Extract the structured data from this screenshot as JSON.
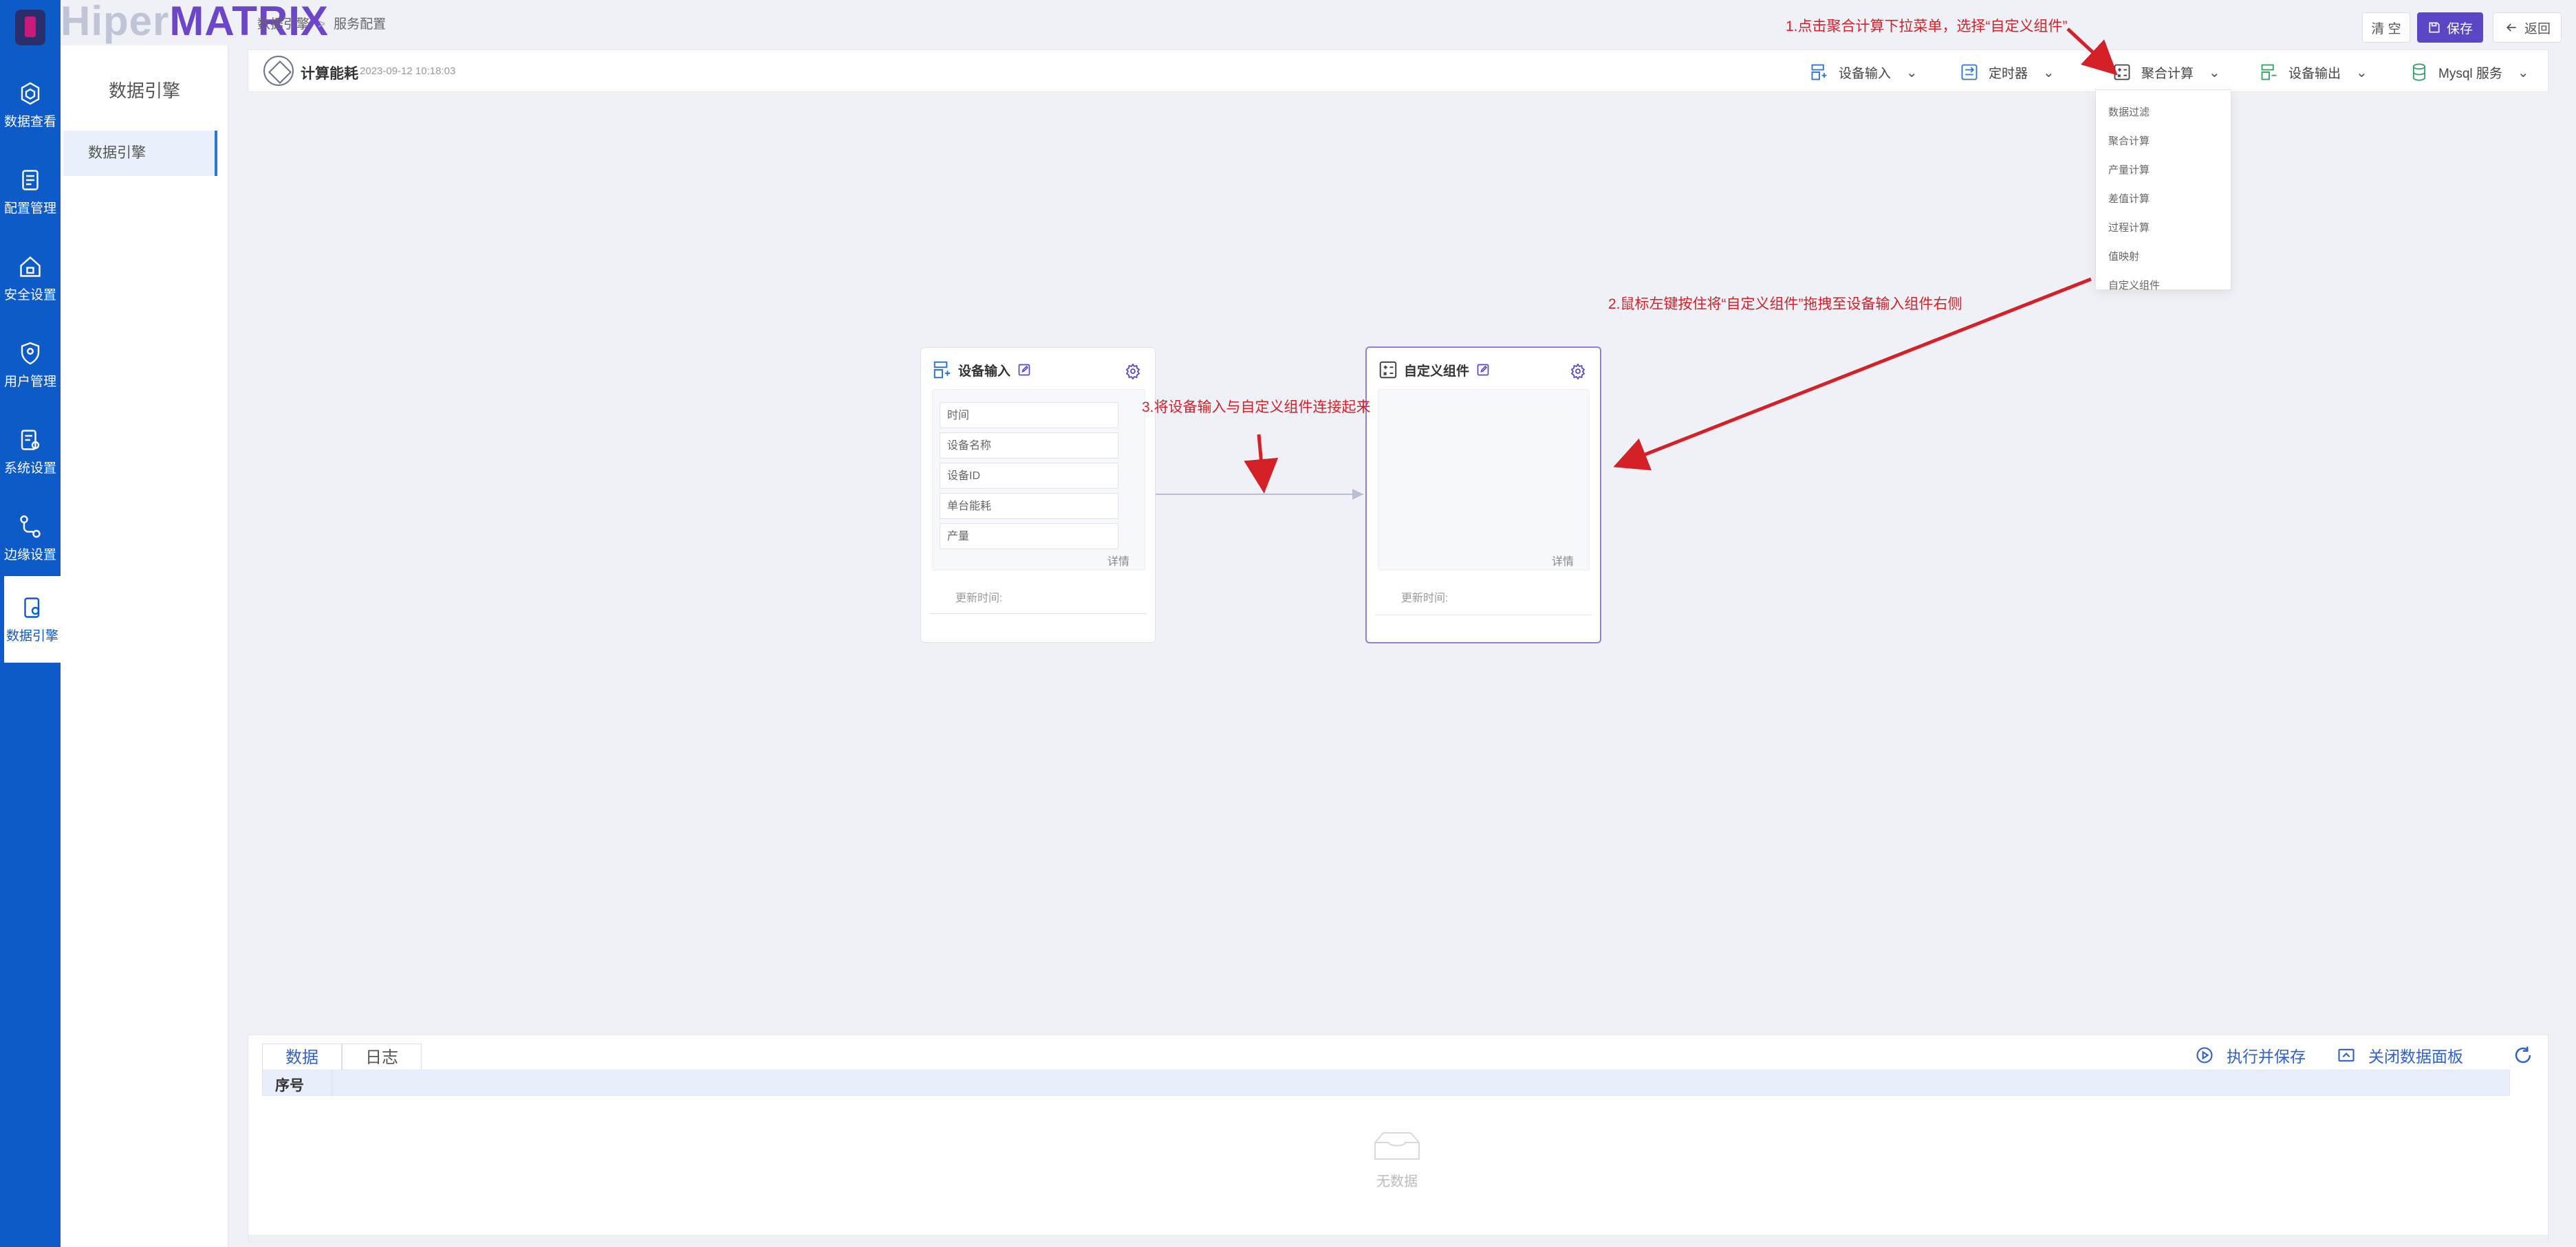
{
  "brand": {
    "part1": "Hiper",
    "part2": "MATRIX"
  },
  "rail": {
    "items": [
      {
        "label": "数据查看",
        "icon": "cube-icon"
      },
      {
        "label": "配置管理",
        "icon": "document-icon"
      },
      {
        "label": "安全设置",
        "icon": "house-lock-icon"
      },
      {
        "label": "用户管理",
        "icon": "shield-user-icon"
      },
      {
        "label": "系统设置",
        "icon": "settings-doc-icon"
      },
      {
        "label": "边缘设置",
        "icon": "workflow-icon"
      },
      {
        "label": "数据引擎",
        "icon": "engine-doc-icon"
      }
    ]
  },
  "sidebar": {
    "title": "数据引擎",
    "items": [
      {
        "label": "数据引擎"
      }
    ]
  },
  "breadcrumb": {
    "items": [
      "数据引擎",
      "服务配置"
    ],
    "separator": ">"
  },
  "topbar": {
    "clear_label": "清 空",
    "save_label": "保存",
    "back_label": "返回"
  },
  "flow": {
    "title": "计算能耗",
    "datetime": "2023-09-12 10:18:03"
  },
  "toolbar": {
    "dropdowns": [
      {
        "label": "设备输入",
        "icon": "device-input-icon"
      },
      {
        "label": "定时器",
        "icon": "timer-icon"
      },
      {
        "label": "聚合计算",
        "icon": "calc-icon"
      },
      {
        "label": "设备输出",
        "icon": "device-output-icon"
      },
      {
        "label": "Mysql 服务",
        "icon": "database-icon"
      }
    ]
  },
  "dropdown_menu": {
    "items": [
      "数据过滤",
      "聚合计算",
      "产量计算",
      "差值计算",
      "过程计算",
      "值映射",
      "自定义组件"
    ]
  },
  "nodes": {
    "device_input": {
      "title": "设备输入",
      "fields": [
        "时间",
        "设备名称",
        "设备ID",
        "单台能耗",
        "产量"
      ],
      "detail_label": "详情",
      "updated_label": "更新时间:"
    },
    "custom": {
      "title": "自定义组件",
      "detail_label": "详情",
      "updated_label": "更新时间:"
    }
  },
  "annotations": {
    "step1": "1.点击聚合计算下拉菜单，选择“自定义组件”",
    "step2": "2.鼠标左键按住将“自定义组件”拖拽至设备输入组件右侧",
    "step3": "3.将设备输入与自定义组件连接起来"
  },
  "bottom_panel": {
    "tabs": [
      "数据",
      "日志"
    ],
    "actions": {
      "execute_save": "执行并保存",
      "close_panel": "关闭数据面板"
    },
    "columns": [
      "序号"
    ],
    "empty_text": "无数据"
  },
  "colors": {
    "rail": "#0d5ac9",
    "accent": "#5b46c5",
    "annotation": "#d42127",
    "link": "#2f62c8"
  }
}
